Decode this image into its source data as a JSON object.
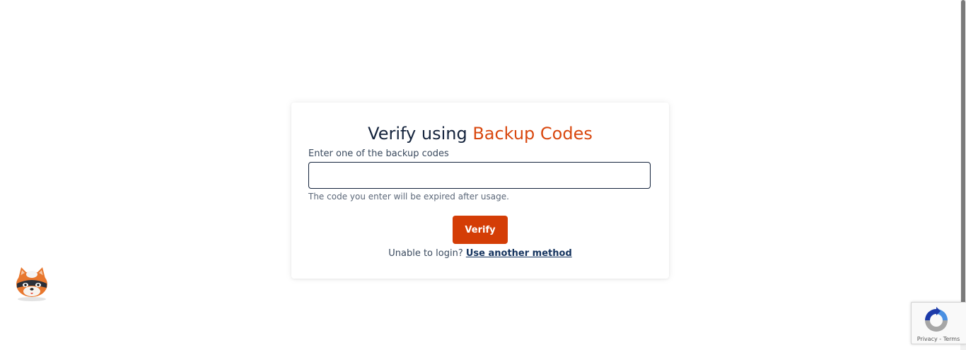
{
  "card": {
    "title_prefix": "Verify using ",
    "title_accent": "Backup Codes",
    "field_label": "Enter one of the backup codes",
    "input_value": "",
    "input_placeholder": "",
    "hint": "The code you enter will be expired after usage.",
    "verify_label": "Verify",
    "alt_prompt": "Unable to login? ",
    "alt_link": "Use another method"
  },
  "recaptcha": {
    "privacy": "Privacy",
    "separator": " - ",
    "terms": "Terms"
  },
  "icons": {
    "mascot": "raccoon-mascot-icon",
    "recaptcha": "recaptcha-logo-icon"
  },
  "colors": {
    "accent": "#d9480f",
    "button": "#d43d06",
    "title": "#14233c",
    "link": "#14335e"
  }
}
